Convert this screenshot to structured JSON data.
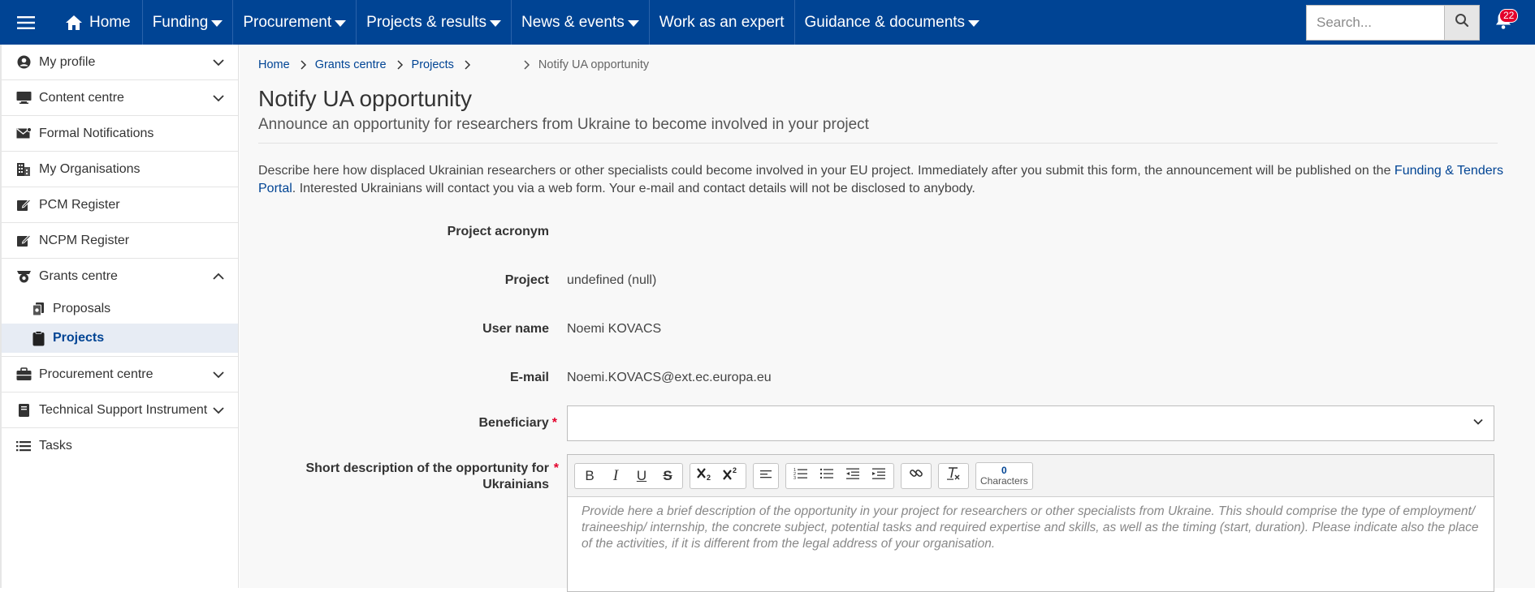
{
  "topnav": {
    "home": "Home",
    "items": [
      {
        "label": "Funding"
      },
      {
        "label": "Procurement"
      },
      {
        "label": "Projects & results"
      },
      {
        "label": "News & events"
      },
      {
        "label": "Work as an expert",
        "no_caret": true
      },
      {
        "label": "Guidance & documents"
      }
    ],
    "search_placeholder": "Search...",
    "notification_count": "22"
  },
  "sidebar": {
    "items": [
      {
        "label": "My profile",
        "icon": "user-circle-icon"
      },
      {
        "label": "Content centre",
        "icon": "monitor-icon"
      },
      {
        "label": "Formal Notifications",
        "icon": "envelope-icon"
      },
      {
        "label": "My Organisations",
        "icon": "building-icon"
      },
      {
        "label": "PCM Register",
        "icon": "edit-square-icon"
      },
      {
        "label": "NCPM Register",
        "icon": "edit-square-icon"
      },
      {
        "label": "Grants centre",
        "icon": "grants-icon"
      },
      {
        "label": "Proposals",
        "icon": "files-icon"
      },
      {
        "label": "Projects",
        "icon": "clipboard-icon"
      },
      {
        "label": "Procurement centre",
        "icon": "briefcase-icon"
      },
      {
        "label": "Technical Support Instrument",
        "icon": "book-icon"
      },
      {
        "label": "Tasks",
        "icon": "list-icon"
      }
    ]
  },
  "breadcrumb": [
    "Home",
    "Grants centre",
    "Projects",
    "Notify UA opportunity"
  ],
  "page": {
    "title": "Notify UA opportunity",
    "subtitle": "Announce an opportunity for researchers from Ukraine to become involved in your project",
    "intro_text": "Describe here how displaced Ukrainian researchers or other specialists could become involved in your EU project. Immediately after you submit this form, the announcement will be published on the ",
    "intro_link": "Funding & Tenders Portal",
    "intro_text_after": ". Interested Ukrainians will contact you via a web form. Your e-mail and contact details will not be disclosed to anybody."
  },
  "form": {
    "acronym_label": "Project acronym",
    "acronym_value": "",
    "project_label": "Project",
    "project_value": "undefined (null)",
    "username_label": "User name",
    "username_value": "Noemi KOVACS",
    "email_label": "E-mail",
    "email_value": "Noemi.KOVACS@ext.ec.europa.eu",
    "beneficiary_label": "Beneficiary",
    "required_marker": "*",
    "short_desc_label": "Short description of the opportunity for Ukrainians",
    "char_count": "0",
    "char_label": "Characters",
    "short_desc_placeholder": "Provide here a brief description of the opportunity in your project for researchers or other specialists from Ukraine. This should comprise the type of employment/ traineeship/ internship, the concrete subject, potential tasks and required expertise and skills, as well as the timing (start, duration). Please indicate also the place of the activities, if it is different from the legal address of your organisation.",
    "toolbar": {
      "bold": "B",
      "italic": "I",
      "underline": "U",
      "strike": "S"
    }
  },
  "colors": {
    "brand": "#004494",
    "required": "#e4002b",
    "badge": "#e4002b"
  }
}
